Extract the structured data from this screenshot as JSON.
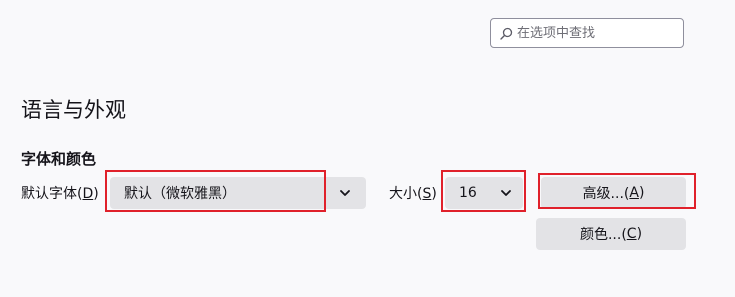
{
  "search": {
    "placeholder": "在选项中查找",
    "value": ""
  },
  "section": {
    "title": "语言与外观"
  },
  "fonts_colors": {
    "heading": "字体和颜色",
    "default_font_label_prefix": "默认字体(",
    "default_font_label_accel": "D",
    "default_font_label_suffix": ")",
    "default_font_value": "默认（微软雅黑）",
    "size_label_prefix": "大小(",
    "size_label_accel": "S",
    "size_label_suffix": ")",
    "size_value": "16",
    "advanced_prefix": "高级...(",
    "advanced_accel": "A",
    "advanced_suffix": ")",
    "colors_prefix": "颜色...(",
    "colors_accel": "C",
    "colors_suffix": ")"
  },
  "icons": {
    "search": "search-icon",
    "chevron": "chevron-down-icon"
  },
  "colors": {
    "background": "#f9f9fb",
    "control_bg": "#e3e3e6",
    "highlight": "#e0212b"
  }
}
